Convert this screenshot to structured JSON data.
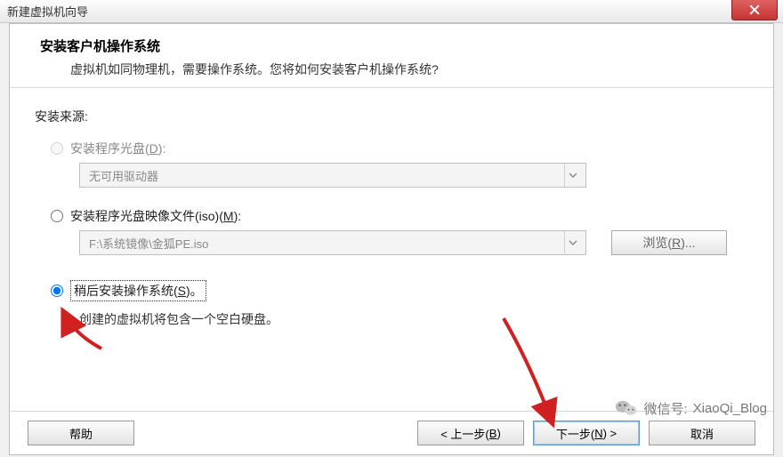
{
  "window": {
    "title": "新建虚拟机向导"
  },
  "header": {
    "title": "安装客户机操作系统",
    "sub": "虚拟机如同物理机，需要操作系统。您将如何安装客户机操作系统?"
  },
  "source": {
    "label": "安装来源:"
  },
  "opt_disc": {
    "label_pre": "安装程序光盘(",
    "key": "D",
    "label_post": "):",
    "dropdown_text": "无可用驱动器"
  },
  "opt_iso": {
    "label_pre": "安装程序光盘映像文件(iso)(",
    "key": "M",
    "label_post": "):",
    "path": "F:\\系统镜像\\金狐PE.iso",
    "browse_pre": "浏览(",
    "browse_key": "R",
    "browse_post": ")..."
  },
  "opt_later": {
    "label_pre": "稍后安装操作系统(",
    "key": "S",
    "label_post": ")。",
    "desc": "创建的虚拟机将包含一个空白硬盘。"
  },
  "footer": {
    "help": "帮助",
    "back_pre": "< 上一步(",
    "back_key": "B",
    "back_post": ")",
    "next_pre": "下一步(",
    "next_key": "N",
    "next_post": ") >",
    "cancel": "取消"
  },
  "watermark": {
    "label": "微信号:",
    "id": "XiaoQi_Blog"
  }
}
